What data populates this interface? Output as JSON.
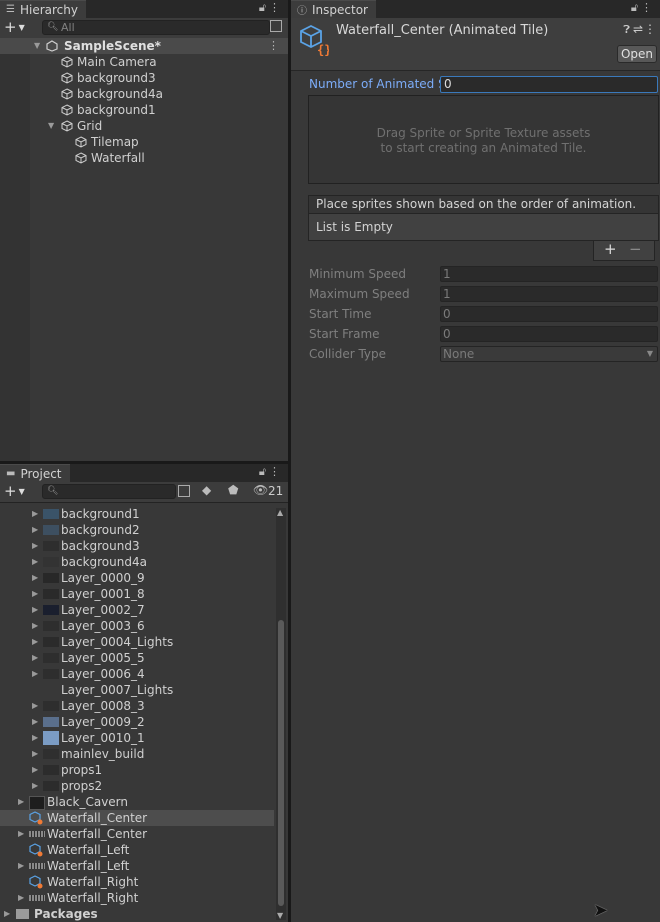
{
  "hierarchy": {
    "tab_label": "Hierarchy",
    "search_placeholder": "All",
    "scene_name": "SampleScene*",
    "items": [
      {
        "label": "Main Camera"
      },
      {
        "label": "background3"
      },
      {
        "label": "background4a"
      },
      {
        "label": "background1"
      },
      {
        "label": "Grid"
      },
      {
        "label": "Tilemap"
      },
      {
        "label": "Waterfall"
      }
    ]
  },
  "inspector": {
    "tab_label": "Inspector",
    "object_title": "Waterfall_Center (Animated Tile)",
    "open_button": "Open",
    "num_sprites_label": "Number of Animated Sp",
    "num_sprites_value": "0",
    "drop_hint_line1": "Drag Sprite or Sprite Texture assets",
    "drop_hint_line2": "to start creating an Animated Tile.",
    "list_header": "Place sprites shown based on the order of animation.",
    "list_empty": "List is Empty",
    "add_glyph": "+",
    "remove_glyph": "−",
    "fields": [
      {
        "label": "Minimum Speed",
        "value": "1"
      },
      {
        "label": "Maximum Speed",
        "value": "1"
      },
      {
        "label": "Start Time",
        "value": "0"
      },
      {
        "label": "Start Frame",
        "value": "0"
      },
      {
        "label": "Collider Type",
        "value": "None"
      }
    ]
  },
  "project": {
    "tab_label": "Project",
    "search_value": "",
    "hidden_count": "21",
    "items": [
      {
        "label": "background1"
      },
      {
        "label": "background2"
      },
      {
        "label": "background3"
      },
      {
        "label": "background4a"
      },
      {
        "label": "Layer_0000_9"
      },
      {
        "label": "Layer_0001_8"
      },
      {
        "label": "Layer_0002_7"
      },
      {
        "label": "Layer_0003_6"
      },
      {
        "label": "Layer_0004_Lights"
      },
      {
        "label": "Layer_0005_5"
      },
      {
        "label": "Layer_0006_4"
      },
      {
        "label": "Layer_0007_Lights"
      },
      {
        "label": "Layer_0008_3"
      },
      {
        "label": "Layer_0009_2"
      },
      {
        "label": "Layer_0010_1"
      },
      {
        "label": "mainlev_build"
      },
      {
        "label": "props1"
      },
      {
        "label": "props2"
      },
      {
        "label": "Black_Cavern"
      },
      {
        "label": "Waterfall_Center"
      },
      {
        "label": "Waterfall_Center"
      },
      {
        "label": "Waterfall_Left"
      },
      {
        "label": "Waterfall_Left"
      },
      {
        "label": "Waterfall_Right"
      },
      {
        "label": "Waterfall_Right"
      },
      {
        "label": "Packages"
      }
    ]
  },
  "colors": {
    "accent_blue": "#7cacf8",
    "tile_icon_blue": "#5aa3e6",
    "tile_icon_orange": "#f07a35"
  }
}
